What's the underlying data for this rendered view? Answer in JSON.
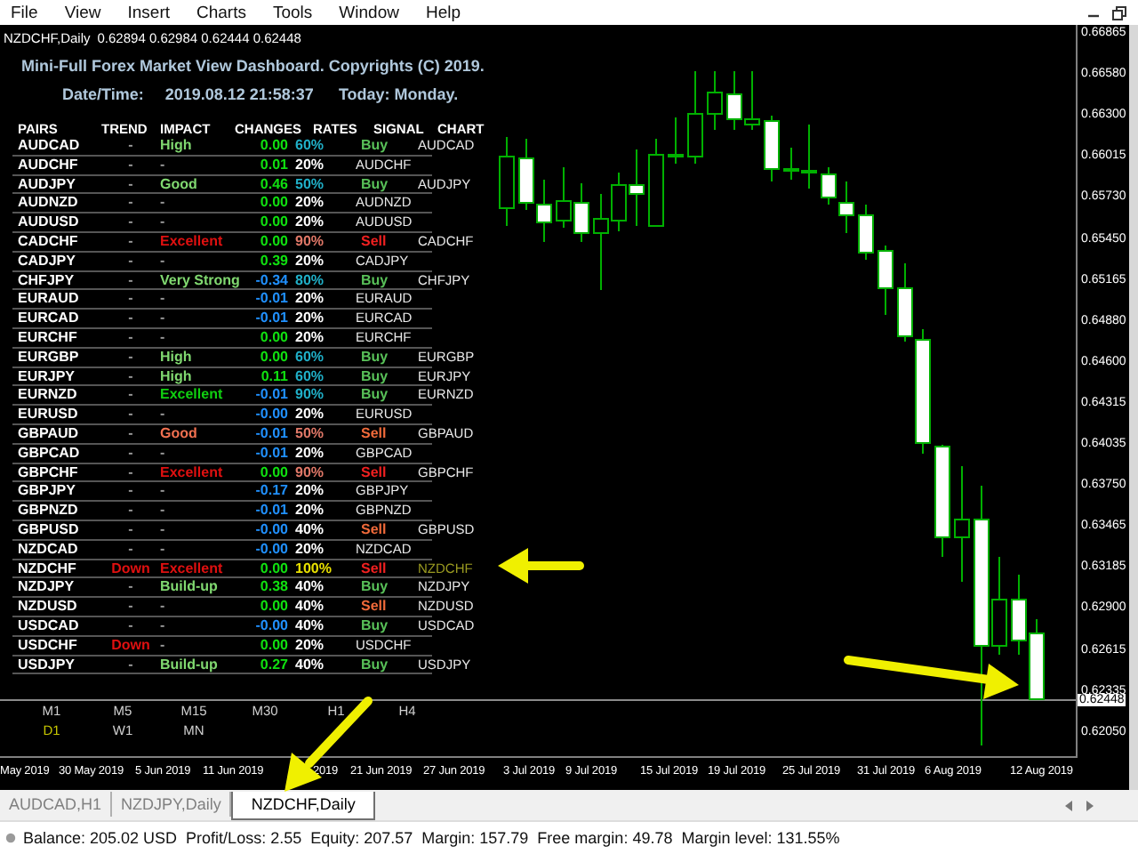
{
  "menu": [
    "File",
    "View",
    "Insert",
    "Charts",
    "Tools",
    "Window",
    "Help"
  ],
  "chart_header": {
    "symbol": "NZDCHF,Daily",
    "prices": "0.62894 0.62984 0.62444 0.62448"
  },
  "dashboard": {
    "title": "Mini-Full Forex Market View Dashboard. Copyrights (C) 2019.",
    "datetime_label": "Date/Time:",
    "datetime": "2019.08.12 21:58:37",
    "today": "Today: Monday.",
    "columns": [
      "PAIRS",
      "TREND",
      "IMPACT",
      "CHANGES",
      "RATES",
      "SIGNAL",
      "CHART"
    ],
    "rows": [
      {
        "pair": "AUDCAD",
        "trend": {
          "text": "-",
          "color": "#9a9a9a"
        },
        "impact": {
          "text": "High",
          "color": "#80d870"
        },
        "change": {
          "text": "0.00",
          "color": "#10e010"
        },
        "rate": {
          "text": "60%",
          "color": "#20b0c8"
        },
        "signal": {
          "text": "Buy",
          "color": "#58c058"
        },
        "chart": {
          "text": "AUDCAD",
          "color": "#e8e8e8"
        }
      },
      {
        "pair": "AUDCHF",
        "trend": {
          "text": "-",
          "color": "#9a9a9a"
        },
        "impact": {
          "text": "-",
          "color": "#9a9a9a"
        },
        "change": {
          "text": "0.01",
          "color": "#10e010"
        },
        "rate": {
          "text": "20%",
          "color": "#ffffff"
        },
        "chart": {
          "text": "AUDCHF",
          "color": "#e8e8e8"
        }
      },
      {
        "pair": "AUDJPY",
        "trend": {
          "text": "-",
          "color": "#9a9a9a"
        },
        "impact": {
          "text": "Good",
          "color": "#80d870"
        },
        "change": {
          "text": "0.46",
          "color": "#10e010"
        },
        "rate": {
          "text": "50%",
          "color": "#20b0c8"
        },
        "signal": {
          "text": "Buy",
          "color": "#58c058"
        },
        "chart": {
          "text": "AUDJPY",
          "color": "#e8e8e8"
        }
      },
      {
        "pair": "AUDNZD",
        "trend": {
          "text": "-",
          "color": "#9a9a9a"
        },
        "impact": {
          "text": "-",
          "color": "#9a9a9a"
        },
        "change": {
          "text": "0.00",
          "color": "#10e010"
        },
        "rate": {
          "text": "20%",
          "color": "#ffffff"
        },
        "chart": {
          "text": "AUDNZD",
          "color": "#e8e8e8"
        }
      },
      {
        "pair": "AUDUSD",
        "trend": {
          "text": "-",
          "color": "#9a9a9a"
        },
        "impact": {
          "text": "-",
          "color": "#9a9a9a"
        },
        "change": {
          "text": "0.00",
          "color": "#10e010"
        },
        "rate": {
          "text": "20%",
          "color": "#ffffff"
        },
        "chart": {
          "text": "AUDUSD",
          "color": "#e8e8e8"
        }
      },
      {
        "pair": "CADCHF",
        "trend": {
          "text": "-",
          "color": "#9a9a9a"
        },
        "impact": {
          "text": "Excellent",
          "color": "#e01010"
        },
        "change": {
          "text": "0.00",
          "color": "#10e010"
        },
        "rate": {
          "text": "90%",
          "color": "#e07868"
        },
        "signal": {
          "text": "Sell",
          "color": "#f02020"
        },
        "chart": {
          "text": "CADCHF",
          "color": "#e8e8e8"
        }
      },
      {
        "pair": "CADJPY",
        "trend": {
          "text": "-",
          "color": "#9a9a9a"
        },
        "impact": {
          "text": "-",
          "color": "#9a9a9a"
        },
        "change": {
          "text": "0.39",
          "color": "#10e010"
        },
        "rate": {
          "text": "20%",
          "color": "#ffffff"
        },
        "chart": {
          "text": "CADJPY",
          "color": "#e8e8e8"
        }
      },
      {
        "pair": "CHFJPY",
        "trend": {
          "text": "-",
          "color": "#9a9a9a"
        },
        "impact": {
          "text": "Very Strong",
          "color": "#80d870"
        },
        "change": {
          "text": "-0.34",
          "color": "#2090ff"
        },
        "rate": {
          "text": "80%",
          "color": "#20b0c8"
        },
        "signal": {
          "text": "Buy",
          "color": "#58c058"
        },
        "chart": {
          "text": "CHFJPY",
          "color": "#e8e8e8"
        }
      },
      {
        "pair": "EURAUD",
        "trend": {
          "text": "-",
          "color": "#9a9a9a"
        },
        "impact": {
          "text": "-",
          "color": "#9a9a9a"
        },
        "change": {
          "text": "-0.01",
          "color": "#2090ff"
        },
        "rate": {
          "text": "20%",
          "color": "#ffffff"
        },
        "chart": {
          "text": "EURAUD",
          "color": "#e8e8e8"
        }
      },
      {
        "pair": "EURCAD",
        "trend": {
          "text": "-",
          "color": "#9a9a9a"
        },
        "impact": {
          "text": "-",
          "color": "#9a9a9a"
        },
        "change": {
          "text": "-0.01",
          "color": "#2090ff"
        },
        "rate": {
          "text": "20%",
          "color": "#ffffff"
        },
        "chart": {
          "text": "EURCAD",
          "color": "#e8e8e8"
        }
      },
      {
        "pair": "EURCHF",
        "trend": {
          "text": "-",
          "color": "#9a9a9a"
        },
        "impact": {
          "text": "-",
          "color": "#9a9a9a"
        },
        "change": {
          "text": "0.00",
          "color": "#10e010"
        },
        "rate": {
          "text": "20%",
          "color": "#ffffff"
        },
        "chart": {
          "text": "EURCHF",
          "color": "#e8e8e8"
        }
      },
      {
        "pair": "EURGBP",
        "trend": {
          "text": "-",
          "color": "#9a9a9a"
        },
        "impact": {
          "text": "High",
          "color": "#80d870"
        },
        "change": {
          "text": "0.00",
          "color": "#10e010"
        },
        "rate": {
          "text": "60%",
          "color": "#20b0c8"
        },
        "signal": {
          "text": "Buy",
          "color": "#58c058"
        },
        "chart": {
          "text": "EURGBP",
          "color": "#e8e8e8"
        }
      },
      {
        "pair": "EURJPY",
        "trend": {
          "text": "-",
          "color": "#9a9a9a"
        },
        "impact": {
          "text": "High",
          "color": "#80d870"
        },
        "change": {
          "text": "0.11",
          "color": "#10e010"
        },
        "rate": {
          "text": "60%",
          "color": "#20b0c8"
        },
        "signal": {
          "text": "Buy",
          "color": "#58c058"
        },
        "chart": {
          "text": "EURJPY",
          "color": "#e8e8e8"
        }
      },
      {
        "pair": "EURNZD",
        "trend": {
          "text": "-",
          "color": "#9a9a9a"
        },
        "impact": {
          "text": "Excellent",
          "color": "#10d010"
        },
        "change": {
          "text": "-0.01",
          "color": "#2090ff"
        },
        "rate": {
          "text": "90%",
          "color": "#20b0c8"
        },
        "signal": {
          "text": "Buy",
          "color": "#58c058"
        },
        "chart": {
          "text": "EURNZD",
          "color": "#e8e8e8"
        }
      },
      {
        "pair": "EURUSD",
        "trend": {
          "text": "-",
          "color": "#9a9a9a"
        },
        "impact": {
          "text": "-",
          "color": "#9a9a9a"
        },
        "change": {
          "text": "-0.00",
          "color": "#2090ff"
        },
        "rate": {
          "text": "20%",
          "color": "#ffffff"
        },
        "chart": {
          "text": "EURUSD",
          "color": "#e8e8e8"
        }
      },
      {
        "pair": "GBPAUD",
        "trend": {
          "text": "-",
          "color": "#9a9a9a"
        },
        "impact": {
          "text": "Good",
          "color": "#f07050"
        },
        "change": {
          "text": "-0.01",
          "color": "#2090ff"
        },
        "rate": {
          "text": "50%",
          "color": "#e07868"
        },
        "signal": {
          "text": "Sell",
          "color": "#f06a3a"
        },
        "chart": {
          "text": "GBPAUD",
          "color": "#e8e8e8"
        }
      },
      {
        "pair": "GBPCAD",
        "trend": {
          "text": "-",
          "color": "#9a9a9a"
        },
        "impact": {
          "text": "-",
          "color": "#9a9a9a"
        },
        "change": {
          "text": "-0.01",
          "color": "#2090ff"
        },
        "rate": {
          "text": "20%",
          "color": "#ffffff"
        },
        "chart": {
          "text": "GBPCAD",
          "color": "#e8e8e8"
        }
      },
      {
        "pair": "GBPCHF",
        "trend": {
          "text": "-",
          "color": "#9a9a9a"
        },
        "impact": {
          "text": "Excellent",
          "color": "#e01010"
        },
        "change": {
          "text": "0.00",
          "color": "#10e010"
        },
        "rate": {
          "text": "90%",
          "color": "#e07868"
        },
        "signal": {
          "text": "Sell",
          "color": "#f02020"
        },
        "chart": {
          "text": "GBPCHF",
          "color": "#e8e8e8"
        }
      },
      {
        "pair": "GBPJPY",
        "trend": {
          "text": "-",
          "color": "#9a9a9a"
        },
        "impact": {
          "text": "-",
          "color": "#9a9a9a"
        },
        "change": {
          "text": "-0.17",
          "color": "#2090ff"
        },
        "rate": {
          "text": "20%",
          "color": "#ffffff"
        },
        "chart": {
          "text": "GBPJPY",
          "color": "#e8e8e8"
        }
      },
      {
        "pair": "GBPNZD",
        "trend": {
          "text": "-",
          "color": "#9a9a9a"
        },
        "impact": {
          "text": "-",
          "color": "#9a9a9a"
        },
        "change": {
          "text": "-0.01",
          "color": "#2090ff"
        },
        "rate": {
          "text": "20%",
          "color": "#ffffff"
        },
        "chart": {
          "text": "GBPNZD",
          "color": "#e8e8e8"
        }
      },
      {
        "pair": "GBPUSD",
        "trend": {
          "text": "-",
          "color": "#9a9a9a"
        },
        "impact": {
          "text": "-",
          "color": "#9a9a9a"
        },
        "change": {
          "text": "-0.00",
          "color": "#2090ff"
        },
        "rate": {
          "text": "40%",
          "color": "#ffffff"
        },
        "signal": {
          "text": "Sell",
          "color": "#f06a3a"
        },
        "chart": {
          "text": "GBPUSD",
          "color": "#e8e8e8"
        }
      },
      {
        "pair": "NZDCAD",
        "trend": {
          "text": "-",
          "color": "#9a9a9a"
        },
        "impact": {
          "text": "-",
          "color": "#9a9a9a"
        },
        "change": {
          "text": "-0.00",
          "color": "#2090ff"
        },
        "rate": {
          "text": "20%",
          "color": "#ffffff"
        },
        "chart": {
          "text": "NZDCAD",
          "color": "#e8e8e8"
        }
      },
      {
        "pair": "NZDCHF",
        "trend": {
          "text": "Down",
          "color": "#e01010"
        },
        "impact": {
          "text": "Excellent",
          "color": "#e01010"
        },
        "change": {
          "text": "0.00",
          "color": "#10e010"
        },
        "rate": {
          "text": "100%",
          "color": "#e8e000"
        },
        "signal": {
          "text": "Sell",
          "color": "#f02020"
        },
        "chart": {
          "text": "NZDCHF",
          "color": "#9a9a20"
        }
      },
      {
        "pair": "NZDJPY",
        "trend": {
          "text": "-",
          "color": "#9a9a9a"
        },
        "impact": {
          "text": "Build-up",
          "color": "#80d870"
        },
        "change": {
          "text": "0.38",
          "color": "#10e010"
        },
        "rate": {
          "text": "40%",
          "color": "#ffffff"
        },
        "signal": {
          "text": "Buy",
          "color": "#58c058"
        },
        "chart": {
          "text": "NZDJPY",
          "color": "#e8e8e8"
        }
      },
      {
        "pair": "NZDUSD",
        "trend": {
          "text": "-",
          "color": "#9a9a9a"
        },
        "impact": {
          "text": "-",
          "color": "#9a9a9a"
        },
        "change": {
          "text": "0.00",
          "color": "#10e010"
        },
        "rate": {
          "text": "40%",
          "color": "#ffffff"
        },
        "signal": {
          "text": "Sell",
          "color": "#f06a3a"
        },
        "chart": {
          "text": "NZDUSD",
          "color": "#e8e8e8"
        }
      },
      {
        "pair": "USDCAD",
        "trend": {
          "text": "-",
          "color": "#9a9a9a"
        },
        "impact": {
          "text": "-",
          "color": "#9a9a9a"
        },
        "change": {
          "text": "-0.00",
          "color": "#2090ff"
        },
        "rate": {
          "text": "40%",
          "color": "#ffffff"
        },
        "signal": {
          "text": "Buy",
          "color": "#58c058"
        },
        "chart": {
          "text": "USDCAD",
          "color": "#e8e8e8"
        }
      },
      {
        "pair": "USDCHF",
        "trend": {
          "text": "Down",
          "color": "#e01010"
        },
        "impact": {
          "text": "-",
          "color": "#9a9a9a"
        },
        "change": {
          "text": "0.00",
          "color": "#10e010"
        },
        "rate": {
          "text": "20%",
          "color": "#ffffff"
        },
        "chart": {
          "text": "USDCHF",
          "color": "#e8e8e8"
        }
      },
      {
        "pair": "USDJPY",
        "trend": {
          "text": "-",
          "color": "#9a9a9a"
        },
        "impact": {
          "text": "Build-up",
          "color": "#80d870"
        },
        "change": {
          "text": "0.27",
          "color": "#10e010"
        },
        "rate": {
          "text": "40%",
          "color": "#ffffff"
        },
        "signal": {
          "text": "Buy",
          "color": "#58c058"
        },
        "chart": {
          "text": "USDJPY",
          "color": "#e8e8e8"
        }
      }
    ],
    "timeframes": [
      {
        "label": "M1",
        "selected": false
      },
      {
        "label": "M5",
        "selected": false
      },
      {
        "label": "M15",
        "selected": false
      },
      {
        "label": "M30",
        "selected": false
      },
      {
        "label": "H1",
        "selected": false
      },
      {
        "label": "H4",
        "selected": false
      },
      {
        "label": "D1",
        "selected": true
      },
      {
        "label": "W1",
        "selected": false
      },
      {
        "label": "MN",
        "selected": false
      }
    ]
  },
  "price_axis": {
    "labels": [
      "0.66865",
      "0.66580",
      "0.66300",
      "0.66015",
      "0.65730",
      "0.65450",
      "0.65165",
      "0.64880",
      "0.64600",
      "0.64315",
      "0.64035",
      "0.63750",
      "0.63465",
      "0.63185",
      "0.62900",
      "0.62615",
      "0.62335",
      "0.62050"
    ],
    "current": "0.62448"
  },
  "date_axis": [
    "May 2019",
    "30 May 2019",
    "5 Jun 2019",
    "11 Jun 2019",
    "2019",
    "21 Jun 2019",
    "27 Jun 2019",
    "3 Jul 2019",
    "9 Jul 2019",
    "15 Jul 2019",
    "19 Jul 2019",
    "25 Jul 2019",
    "31 Jul 2019",
    "6 Aug 2019",
    "12 Aug 2019"
  ],
  "tabs": [
    {
      "label": "AUDCAD,H1",
      "selected": false
    },
    {
      "label": "NZDJPY,Daily",
      "selected": false
    },
    {
      "label": "NZDCHF,Daily",
      "selected": true
    }
  ],
  "status_bar": "Balance: 205.02 USD  Profit/Loss: 2.55  Equity: 207.57  Margin: 157.79  Free margin: 49.78  Margin level: 131.55%"
}
